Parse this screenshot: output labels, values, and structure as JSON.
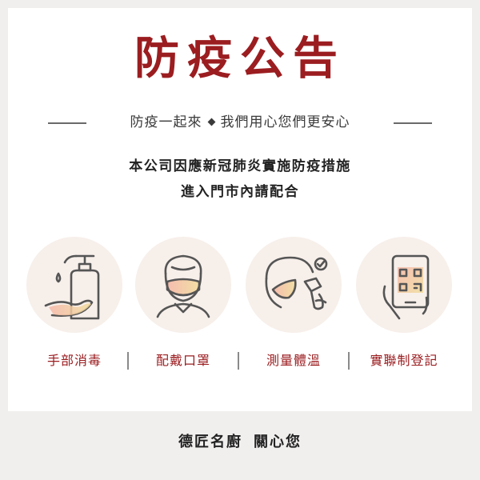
{
  "header": {
    "title": "防疫公告",
    "slogan_left": "防疫一起來",
    "slogan_right": "我們用心您們更安心"
  },
  "notice": {
    "line1": "本公司因應新冠肺炎實施防疫措施",
    "line2": "進入門市內請配合"
  },
  "measures": [
    {
      "label": "手部消毒",
      "icon": "hand-sanitizer-icon"
    },
    {
      "label": "配戴口罩",
      "icon": "face-mask-icon"
    },
    {
      "label": "測量體溫",
      "icon": "thermometer-icon"
    },
    {
      "label": "實聯制登記",
      "icon": "qr-phone-icon"
    }
  ],
  "footer": {
    "brand": "德匠名廚",
    "message": "關心您"
  },
  "colors": {
    "accent": "#9b1d20",
    "background": "#f1efee",
    "icon_circle": "#f7efea",
    "icon_stroke": "#555555",
    "gradient_start": "#f5b7a8",
    "gradient_end": "#f1dc9c"
  }
}
